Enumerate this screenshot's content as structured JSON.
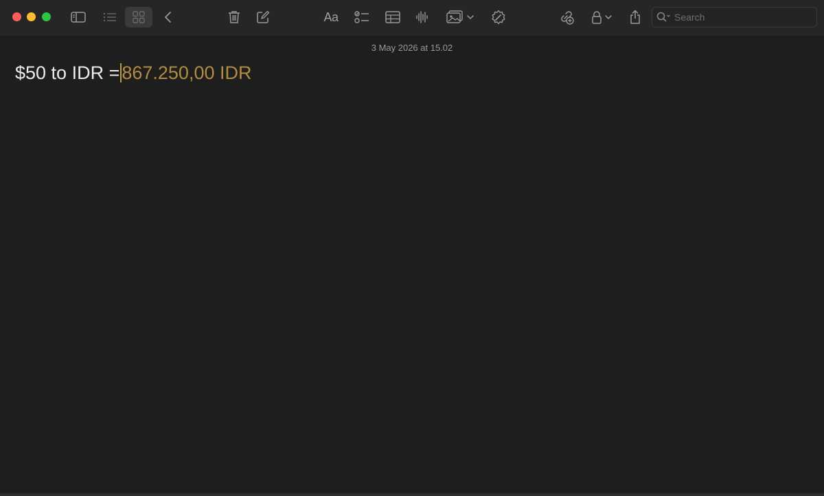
{
  "window": {
    "accent": "#b38d3e"
  },
  "toolbar": {
    "icons": [
      "sidebar-icon",
      "list-view-icon",
      "gallery-view-icon",
      "back-icon",
      "trash-icon",
      "compose-icon",
      "format-icon",
      "checklist-icon",
      "table-icon",
      "audio-icon",
      "media-icon",
      "writing-tools-icon",
      "collaborate-icon",
      "lock-icon",
      "share-icon",
      "search-icon"
    ],
    "format_label": "Aa",
    "search_placeholder": "Search",
    "search_value": ""
  },
  "note": {
    "date": "3 May 2026 at 15.02",
    "expression": "$50 to IDR =",
    "result": "867.250,00 IDR"
  }
}
